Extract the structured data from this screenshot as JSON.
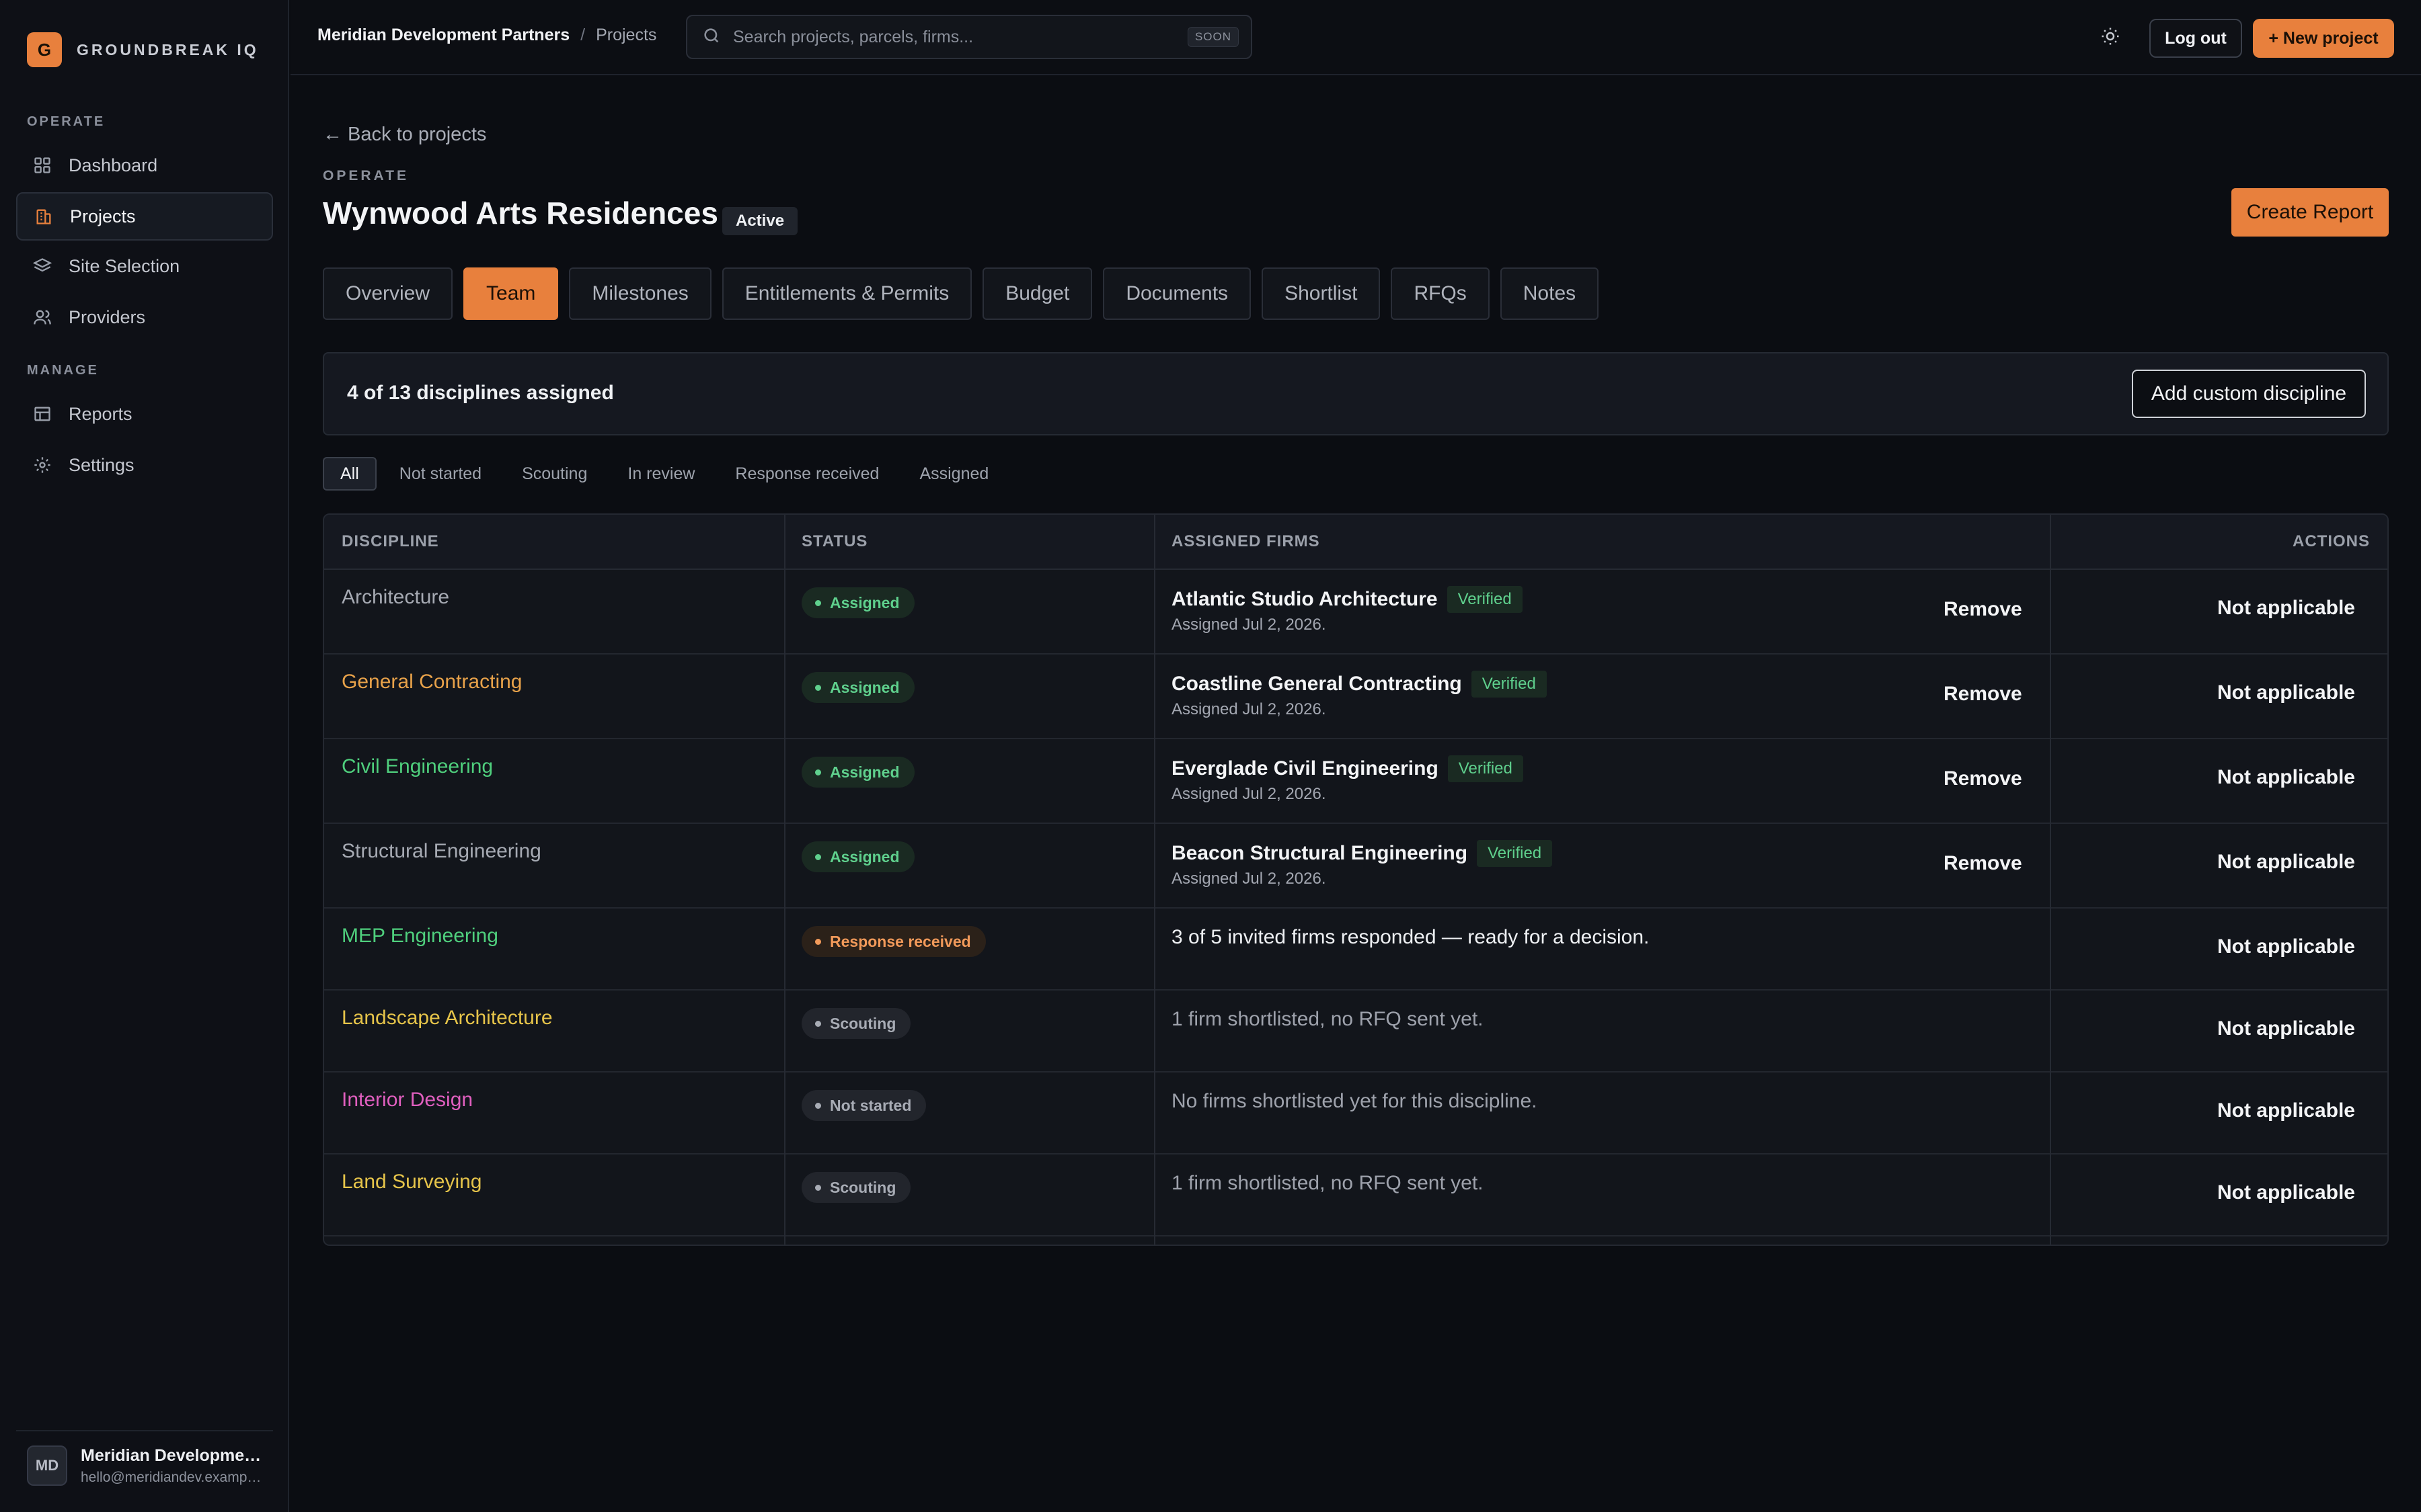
{
  "brand": {
    "logo_letter": "G",
    "name": "GROUNDBREAK IQ"
  },
  "sidebar": {
    "sections": [
      {
        "title": "OPERATE"
      },
      {
        "title": "MANAGE"
      }
    ],
    "items": [
      {
        "label": "Dashboard",
        "icon": "grid-icon"
      },
      {
        "label": "Projects",
        "icon": "building-icon",
        "active": true
      },
      {
        "label": "Site Selection",
        "icon": "layers-icon"
      },
      {
        "label": "Providers",
        "icon": "users-icon"
      },
      {
        "label": "Reports",
        "icon": "table-icon"
      },
      {
        "label": "Settings",
        "icon": "gear-icon"
      }
    ],
    "user": {
      "initials": "MD",
      "name": "Meridian Development Partners",
      "email": "hello@meridiandev.example.com"
    }
  },
  "topbar": {
    "org": "Meridian Development Partners",
    "separator": "/",
    "page": "Projects",
    "search_placeholder": "Search projects, parcels, firms...",
    "search_badge": "SOON",
    "logout": "Log out",
    "new_project": "+ New project"
  },
  "header": {
    "back": "← Back to projects",
    "eyebrow": "OPERATE",
    "title": "Wynwood Arts Residences",
    "status": "Active",
    "create_report": "Create Report"
  },
  "tabs": [
    "Overview",
    "Team",
    "Milestones",
    "Entitlements & Permits",
    "Budget",
    "Documents",
    "Shortlist",
    "RFQs",
    "Notes"
  ],
  "active_tab": "Team",
  "summary": {
    "text": "4 of 13 disciplines assigned",
    "add_button": "Add custom discipline"
  },
  "filters": [
    "All",
    "Not started",
    "Scouting",
    "In review",
    "Response received",
    "Assigned"
  ],
  "active_filter": "All",
  "table": {
    "headers": {
      "discipline": "DISCIPLINE",
      "status": "STATUS",
      "firms": "ASSIGNED FIRMS",
      "actions": "ACTIONS"
    },
    "rows": [
      {
        "discipline": "Architecture",
        "color": "#a6aab3",
        "status": "Assigned",
        "tone": "green",
        "firm": "Atlantic Studio Architecture",
        "verified": "Verified",
        "date": "Assigned Jul 2, 2026.",
        "remove": "Remove",
        "action": "Not applicable"
      },
      {
        "discipline": "General Contracting",
        "color": "#e8a24a",
        "status": "Assigned",
        "tone": "green",
        "firm": "Coastline General Contracting",
        "verified": "Verified",
        "date": "Assigned Jul 2, 2026.",
        "remove": "Remove",
        "action": "Not applicable"
      },
      {
        "discipline": "Civil Engineering",
        "color": "#4fcf7d",
        "status": "Assigned",
        "tone": "green",
        "firm": "Everglade Civil Engineering",
        "verified": "Verified",
        "date": "Assigned Jul 2, 2026.",
        "remove": "Remove",
        "action": "Not applicable"
      },
      {
        "discipline": "Structural Engineering",
        "color": "#a6aab3",
        "status": "Assigned",
        "tone": "green",
        "firm": "Beacon Structural Engineering",
        "verified": "Verified",
        "date": "Assigned Jul 2, 2026.",
        "remove": "Remove",
        "action": "Not applicable"
      },
      {
        "discipline": "MEP Engineering",
        "color": "#4fcf7d",
        "status": "Response received",
        "tone": "orange",
        "note": "3 of 5 invited firms responded — ready for a decision.",
        "action": "Not applicable"
      },
      {
        "discipline": "Landscape Architecture",
        "color": "#e6c44a",
        "status": "Scouting",
        "tone": "gray",
        "note": "1 firm shortlisted, no RFQ sent yet.",
        "action": "Not applicable"
      },
      {
        "discipline": "Interior Design",
        "color": "#e05fbf",
        "status": "Not started",
        "tone": "gray",
        "note": "No firms shortlisted yet for this discipline.",
        "action": "Not applicable"
      },
      {
        "discipline": "Land Surveying",
        "color": "#e6c44a",
        "status": "Scouting",
        "tone": "gray",
        "note": "1 firm shortlisted, no RFQ sent yet.",
        "action": "Not applicable"
      }
    ]
  },
  "colors": {
    "accent": "#e8803d",
    "verified": "#5fd08d",
    "background": "#0b0d12"
  }
}
